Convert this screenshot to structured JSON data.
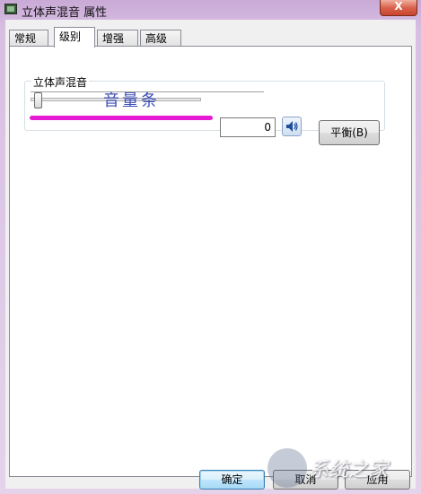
{
  "window": {
    "title": "立体声混音 属性",
    "close_label": "X"
  },
  "tabs": [
    {
      "label": "常规",
      "active": false
    },
    {
      "label": "级别",
      "active": true
    },
    {
      "label": "增强",
      "active": false
    },
    {
      "label": "高级",
      "active": false
    }
  ],
  "levels": {
    "group_label": "立体声混音",
    "volume_value": "0",
    "slider_level": 0,
    "speaker_icon": "speaker-icon",
    "balance_label": "平衡(B)"
  },
  "annotation": {
    "text": "音量条",
    "color": "#e51ad2"
  },
  "footer": {
    "ok_label": "确定",
    "cancel_label": "取消",
    "apply_label": "应用"
  },
  "watermark": {
    "text": "系统之家"
  }
}
